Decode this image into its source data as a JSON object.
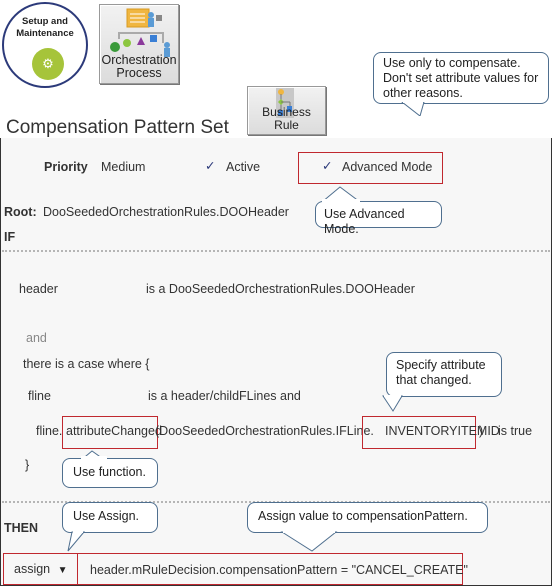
{
  "icons": {
    "setup_maintenance": {
      "label_line1": "Setup and",
      "label_line2": "Maintenance",
      "glyph": "gears"
    },
    "orchestration_process": {
      "label_line1": "Orchestration",
      "label_line2": "Process"
    },
    "business_rule": {
      "label_line1": "Business",
      "label_line2": "Rule"
    }
  },
  "panel": {
    "title": "Compensation Pattern Set",
    "priority_label": "Priority",
    "priority_value": "Medium",
    "active_check": "✓",
    "active_label": "Active",
    "advanced_check": "✓",
    "advanced_label": "Advanced Mode",
    "root_label": "Root:",
    "root_value": "DooSeededOrchestrationRules.DOOHeader",
    "if_label": "IF",
    "then_label": "THEN",
    "conditions": {
      "header_var": "header",
      "header_type": "is a  DooSeededOrchestrationRules.DOOHeader",
      "and_label": "and",
      "case_where": "there is a case where  {",
      "fline_var": "fline",
      "fline_type": "is a  header/childFLines   and",
      "fline_prefix": "fline.",
      "function_name": "attributeChanged",
      "function_arg_prefix": "(DooSeededOrchestrationRules.IFLine.",
      "attribute_name": "INVENTORYITEMID",
      "function_suffix": ")",
      "is_true": "is true",
      "close_brace": "}"
    },
    "action": {
      "type": "assign",
      "dropdown_glyph": "▼",
      "expression": "header.mRuleDecision.compensationPattern   = \"CANCEL_CREATE\""
    }
  },
  "callouts": {
    "compensate": "Use only to compensate. Don't set attribute values for other reasons.",
    "advanced_mode": "Use Advanced  Mode.",
    "specify_attribute": "Specify attribute that changed.",
    "use_function": "Use function.",
    "use_assign": "Use Assign.",
    "assign_value": "Assign value  to compensationPattern."
  },
  "colors": {
    "highlight_border": "#c0282f",
    "callout_border": "#4f6f8f",
    "check_color": "#2c3a7a",
    "gear_green": "#a6c43a"
  }
}
